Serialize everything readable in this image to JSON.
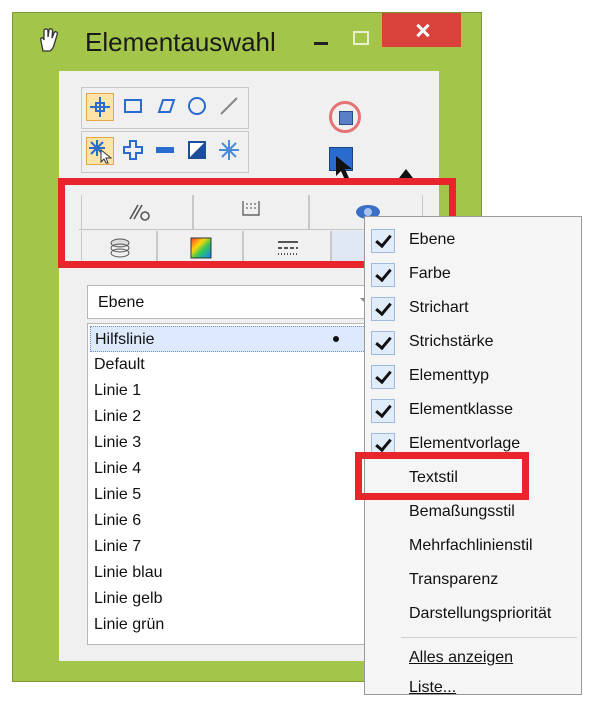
{
  "window": {
    "title": "Elementauswahl",
    "accent_color": "#a3c64a",
    "close_color": "#d9413b"
  },
  "tabs_row1": [
    "tab-attributes",
    "tab-levels",
    "tab-views"
  ],
  "tabs_row2": [
    "layer-icon",
    "color-icon",
    "linestyle-icon",
    "list-icon"
  ],
  "combo": {
    "value": "Ebene"
  },
  "list": {
    "items": [
      "Hilfslinie",
      "Default",
      "Linie 1",
      "Linie 2",
      "Linie 3",
      "Linie 4",
      "Linie 5",
      "Linie 6",
      "Linie 7",
      "Linie blau",
      "Linie gelb",
      "Linie grün"
    ],
    "selected": "Hilfslinie"
  },
  "menu": {
    "items": [
      {
        "label": "Ebene",
        "checked": true
      },
      {
        "label": "Farbe",
        "checked": true
      },
      {
        "label": "Strichart",
        "checked": true
      },
      {
        "label": "Strichstärke",
        "checked": true
      },
      {
        "label": "Elementtyp",
        "checked": true
      },
      {
        "label": "Elementklasse",
        "checked": true
      },
      {
        "label": "Elementvorlage",
        "checked": true
      },
      {
        "label": "Textstil",
        "checked": false
      },
      {
        "label": "Bemaßungsstil",
        "checked": false
      },
      {
        "label": "Mehrfachlinienstil",
        "checked": false
      },
      {
        "label": "Transparenz",
        "checked": false
      },
      {
        "label": "Darstellungspriorität",
        "checked": false
      }
    ],
    "footer": [
      {
        "label": "Alles anzeigen"
      },
      {
        "label": "Liste..."
      }
    ]
  },
  "highlight_color": "#e8252d"
}
